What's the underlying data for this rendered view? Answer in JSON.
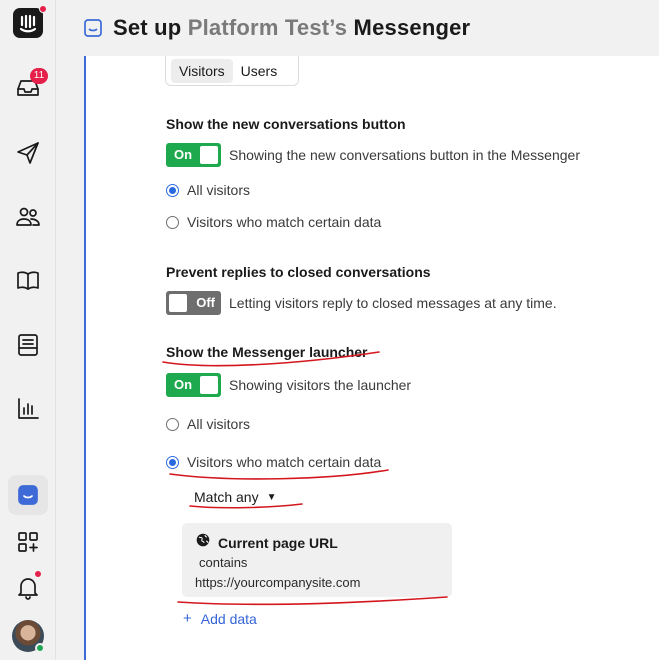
{
  "sidebar": {
    "inbox_badge": "11",
    "items": [
      {
        "name": "intercom-logo"
      },
      {
        "name": "inbox"
      },
      {
        "name": "outbound"
      },
      {
        "name": "contacts"
      },
      {
        "name": "articles"
      },
      {
        "name": "operator"
      },
      {
        "name": "reports"
      },
      {
        "name": "messenger"
      },
      {
        "name": "apps"
      },
      {
        "name": "notifications"
      },
      {
        "name": "user-avatar"
      }
    ]
  },
  "header": {
    "prefix": "Set up",
    "workspace": "Platform Test’s",
    "suffix": "Messenger"
  },
  "audience_tabs": [
    "Visitors",
    "Users"
  ],
  "new_conversations": {
    "title": "Show the new conversations button",
    "toggle": "On",
    "description": "Showing the new conversations button in the Messenger",
    "options": [
      "All visitors",
      "Visitors who match certain data"
    ],
    "selected": 0
  },
  "prevent_replies": {
    "title": "Prevent replies to closed conversations",
    "toggle": "Off",
    "description": "Letting visitors reply to closed messages at any time."
  },
  "launcher": {
    "title": "Show the Messenger launcher",
    "toggle": "On",
    "description": "Showing visitors the launcher",
    "options": [
      "All visitors",
      "Visitors who match certain data"
    ],
    "selected": 1,
    "match": "Match any",
    "rule": {
      "attribute": "Current page URL",
      "operator": "contains",
      "value": "https://yourcompanysite.com"
    },
    "add_data": "Add data"
  },
  "colors": {
    "accent": "#3d6ad6",
    "toggle_on": "#1fa94e",
    "toggle_off": "#6e6e6e",
    "badge": "#e5204a",
    "annotation": "#d4171e"
  }
}
